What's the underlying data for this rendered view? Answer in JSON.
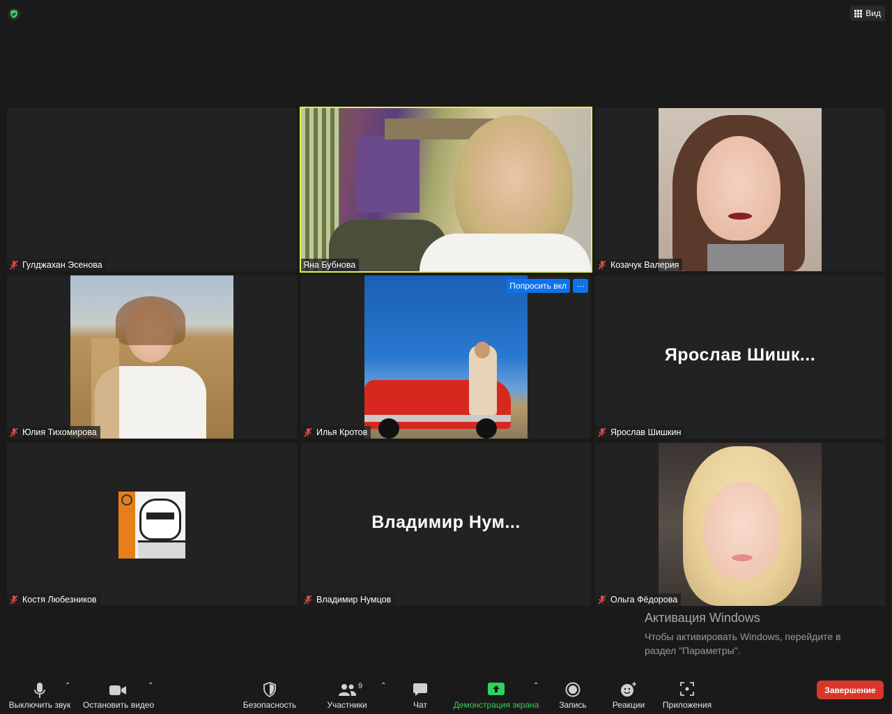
{
  "topbar": {
    "view_label": "Вид"
  },
  "participants": [
    {
      "name": "Гулджахан Эсенова",
      "muted": true,
      "video": false,
      "display": ""
    },
    {
      "name": "Яна Бубнова",
      "muted": false,
      "video": true,
      "active": true
    },
    {
      "name": "Козачук Валерия",
      "muted": true,
      "video": true
    },
    {
      "name": "Юлия Тихомирова",
      "muted": true,
      "video": true
    },
    {
      "name": "Илья Кротов",
      "muted": true,
      "video": true,
      "overlay": {
        "ask_label": "Попросить вкл",
        "more_label": "···"
      }
    },
    {
      "name": "Ярослав Шишкин",
      "muted": true,
      "video": false,
      "display": "Ярослав  Шишк..."
    },
    {
      "name": "Костя Любезников",
      "muted": true,
      "video": false,
      "avatar": true
    },
    {
      "name": "Владимир Нумцов",
      "muted": true,
      "video": false,
      "display": "Владимир  Нум..."
    },
    {
      "name": "Ольга Фёдорова",
      "muted": true,
      "video": true
    }
  ],
  "watermark": {
    "title": "Активация Windows",
    "text": "Чтобы активировать Windows, перейдите в раздел \"Параметры\"."
  },
  "toolbar": {
    "mute": "Выключить звук",
    "stop_video": "Остановить видео",
    "security": "Безопасность",
    "participants": "Участники",
    "participants_count": "9",
    "chat": "Чат",
    "share": "Демонстрация экрана",
    "record": "Запись",
    "reactions": "Реакции",
    "apps": "Приложения",
    "end": "Завершение"
  },
  "colors": {
    "active_border": "#e6f04a",
    "share_green": "#2ed35c",
    "end_red": "#d9362b",
    "ask_blue": "#0e72ed"
  }
}
